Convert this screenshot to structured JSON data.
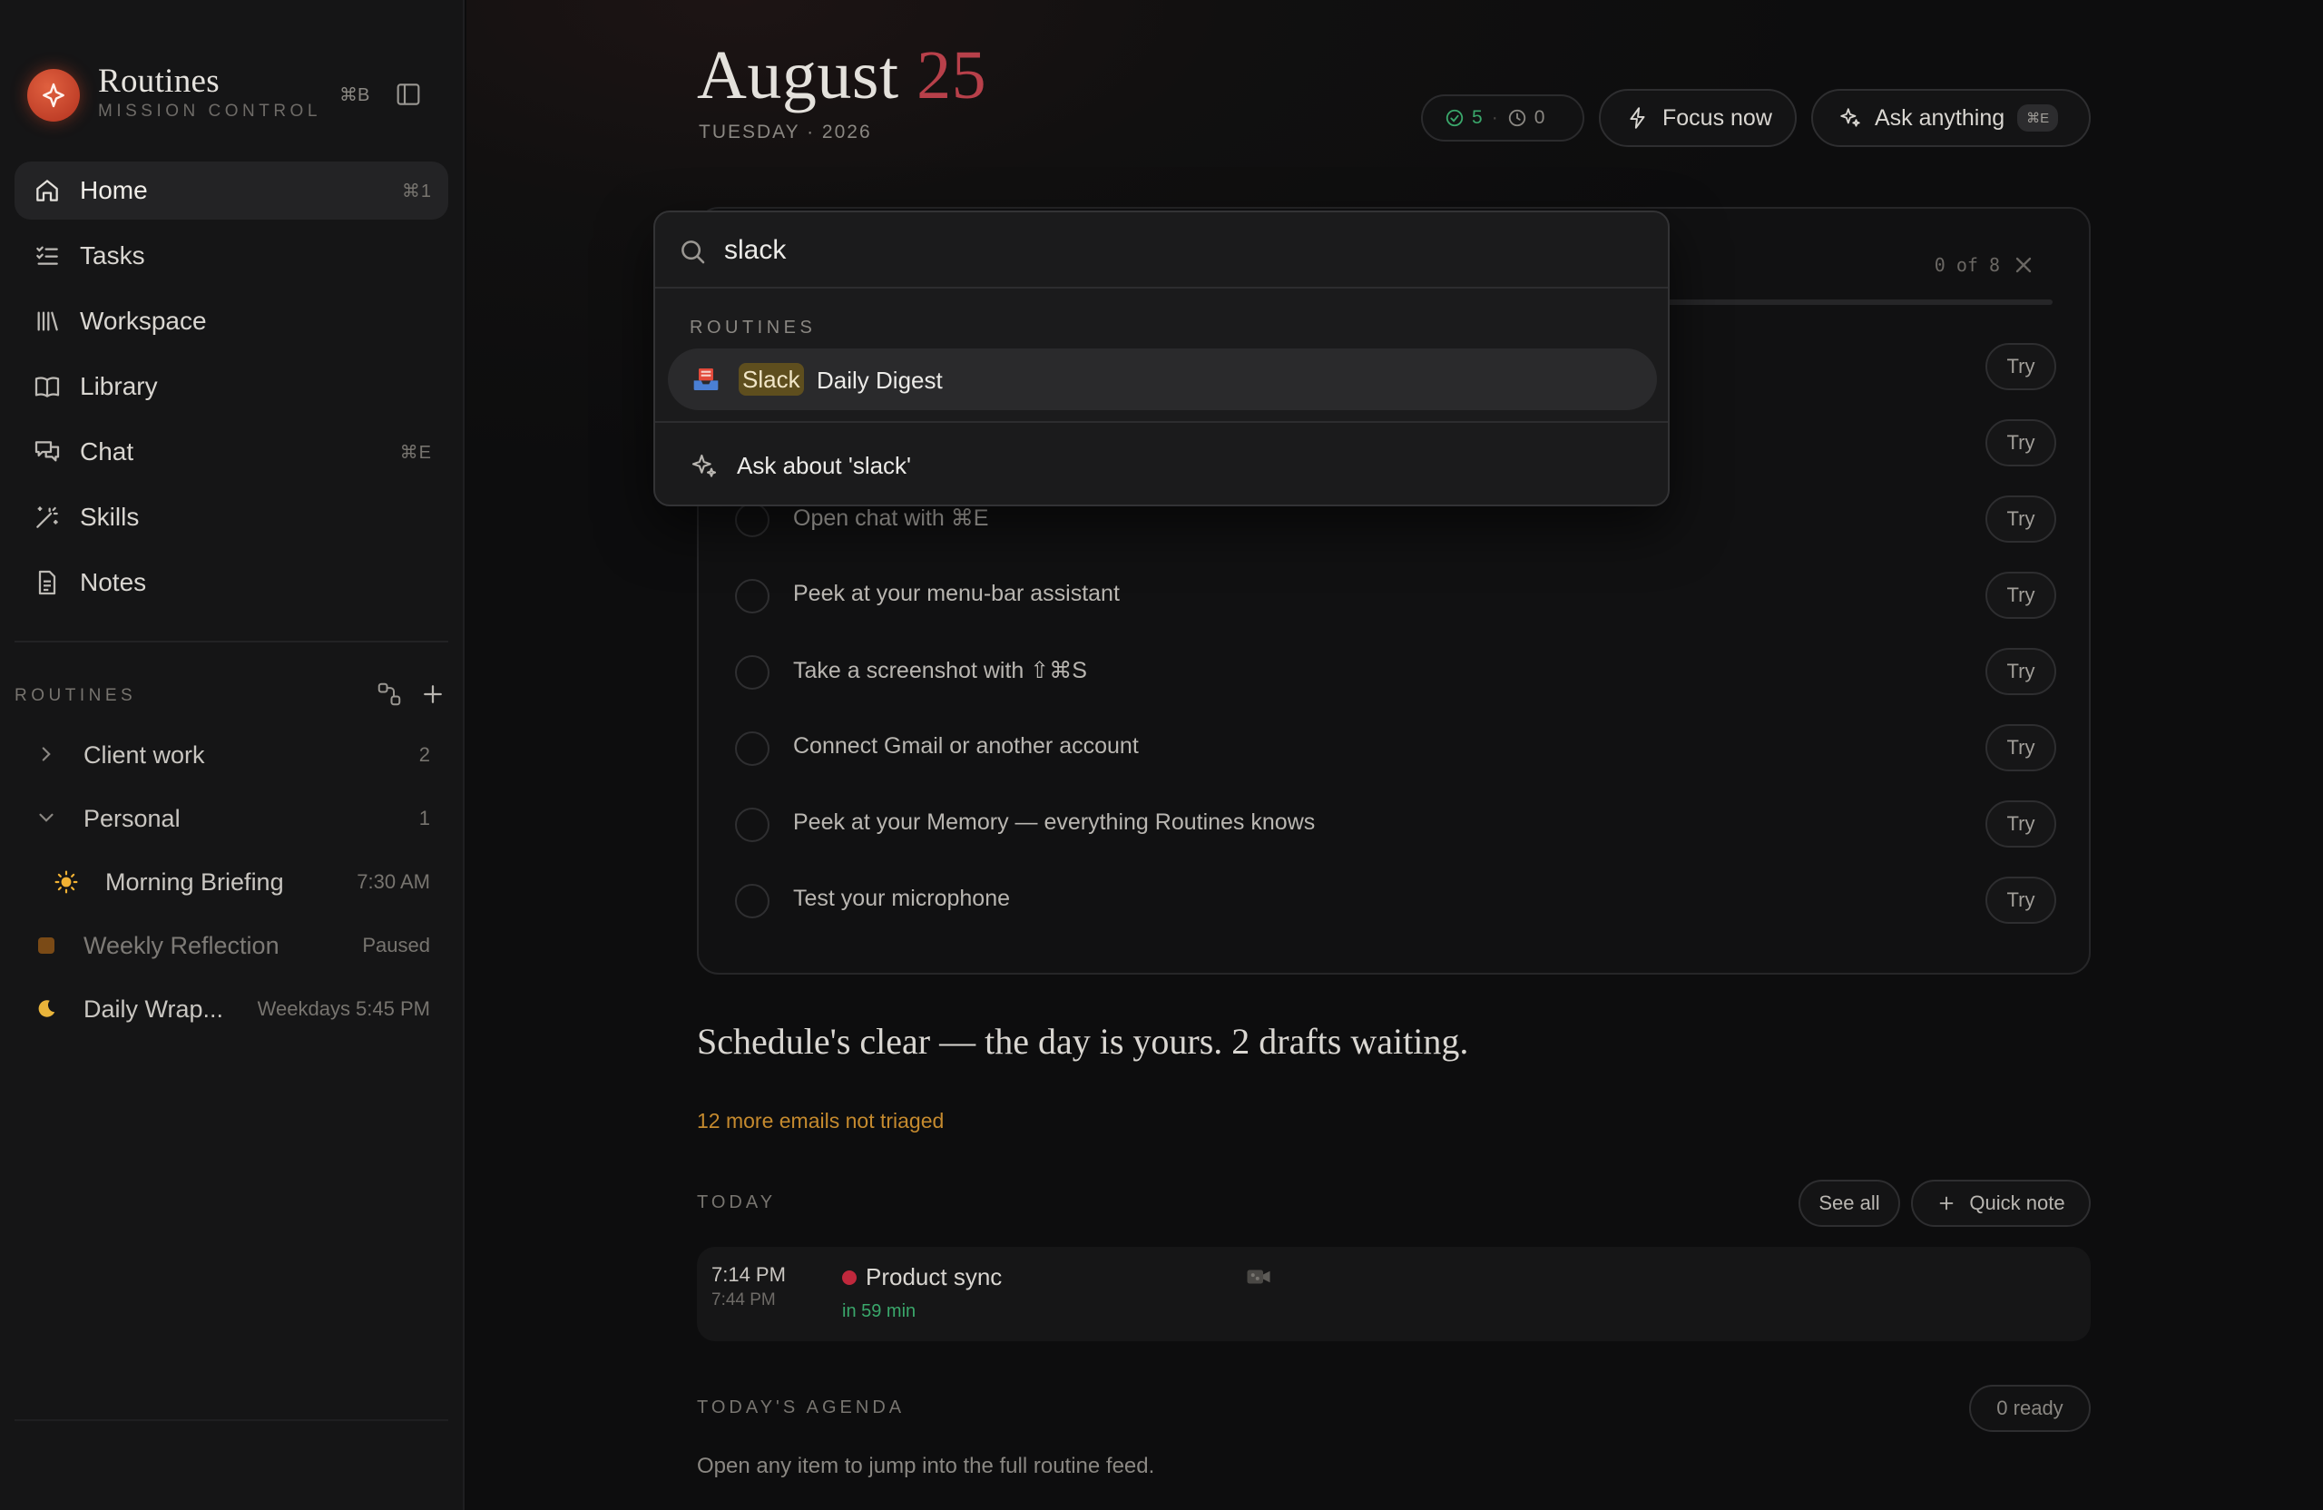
{
  "brand": {
    "name": "Routines",
    "subtitle": "MISSION CONTROL",
    "shortcut": "⌘B"
  },
  "nav": [
    {
      "label": "Home",
      "icon": "home-icon",
      "shortcut": "⌘1",
      "active": true
    },
    {
      "label": "Tasks",
      "icon": "task-list-icon",
      "shortcut": ""
    },
    {
      "label": "Workspace",
      "icon": "library-shelf-icon",
      "shortcut": ""
    },
    {
      "label": "Library",
      "icon": "book-icon",
      "shortcut": ""
    },
    {
      "label": "Chat",
      "icon": "chat-bubbles-icon",
      "shortcut": "⌘E"
    },
    {
      "label": "Skills",
      "icon": "magic-wand-icon",
      "shortcut": ""
    },
    {
      "label": "Notes",
      "icon": "document-icon",
      "shortcut": ""
    }
  ],
  "routines": {
    "title": "ROUTINES",
    "groups": [
      {
        "name": "Client work",
        "count": "2",
        "expanded": false
      },
      {
        "name": "Personal",
        "count": "1",
        "expanded": true
      }
    ],
    "items": [
      {
        "name": "Morning Briefing",
        "meta": "7:30 AM",
        "icon": "sun-icon"
      },
      {
        "name": "Weekly Reflection",
        "meta": "Paused",
        "icon": "paused-square-icon"
      },
      {
        "name": "Daily Wrap...",
        "meta": "Weekdays 5:45 PM",
        "icon": "moon-icon"
      }
    ]
  },
  "header": {
    "month": "August",
    "day": "25",
    "subtitle": "TUESDAY · 2026",
    "done_count": "5",
    "pending_count": "0",
    "focus_label": "Focus now",
    "ask_label": "Ask anything",
    "ask_shortcut": "⌘E"
  },
  "checklist": {
    "counter": "0 of 8",
    "try_label": "Try",
    "tasks": [
      "Open chat with ⌘E",
      "Peek at your menu-bar assistant",
      "Take a screenshot with ⇧⌘S",
      "Connect Gmail or another account",
      "Peek at your Memory — everything Routines knows",
      "Test your microphone"
    ]
  },
  "summary": {
    "headline": "Schedule's clear — the day is yours. 2 drafts waiting.",
    "emails": "12 more emails not triaged"
  },
  "today": {
    "label": "TODAY",
    "see_all": "See all",
    "quick_note": "Quick note",
    "event": {
      "start": "7:14 PM",
      "end": "7:44 PM",
      "title": "Product sync",
      "relative": "in 59 min",
      "color": "#c0283c"
    }
  },
  "agenda": {
    "label": "TODAY'S AGENDA",
    "ready": "0 ready",
    "note": "Open any item to jump into the full routine feed."
  },
  "search": {
    "query": "slack",
    "section": "ROUTINES",
    "result_highlight": "Slack",
    "result_rest": "Daily Digest",
    "ask": "Ask about 'slack'"
  },
  "colors": {
    "accent_red": "#b8404a",
    "success": "#3aa76b",
    "warning": "#c58a2e",
    "highlight": "#5e4e1e"
  }
}
